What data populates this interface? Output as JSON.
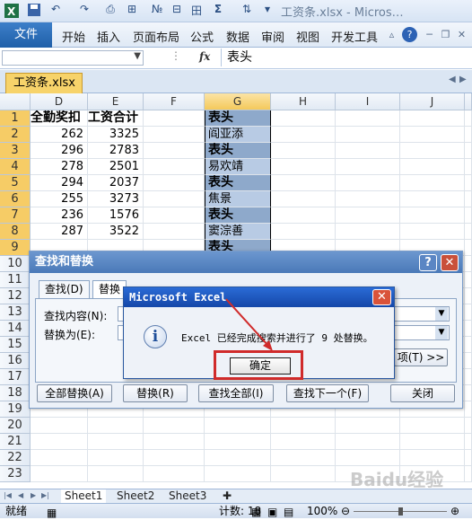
{
  "titlebar": {
    "title": "工资条.xlsx - Micros…"
  },
  "ribbon": {
    "file": "文件",
    "tabs": [
      "开始",
      "插入",
      "页面布局",
      "公式",
      "数据",
      "审阅",
      "视图",
      "开发工具"
    ]
  },
  "formula_bar": {
    "fx": "fx",
    "content": "表头"
  },
  "workbook_tab": "工资条.xlsx",
  "columns": [
    "D",
    "E",
    "F",
    "G",
    "H",
    "I",
    "J"
  ],
  "rows": [
    "1",
    "2",
    "3",
    "4",
    "5",
    "6",
    "7",
    "8",
    "9",
    "10",
    "11",
    "12",
    "13",
    "14",
    "15",
    "16",
    "17",
    "18",
    "19",
    "20",
    "21",
    "22",
    "23"
  ],
  "col_d": [
    "全勤奖扣",
    "262",
    "296",
    "278",
    "294",
    "255",
    "236",
    "287"
  ],
  "col_e": [
    "工资合计",
    "3325",
    "2783",
    "2501",
    "2037",
    "3273",
    "1576",
    "3522"
  ],
  "col_g": [
    "表头",
    "阎亚添",
    "表头",
    "易欢靖",
    "表头",
    "焦景",
    "表头",
    "窦淙善",
    "表头"
  ],
  "sheets": [
    "Sheet1",
    "Sheet2",
    "Sheet3"
  ],
  "status": {
    "ready": "就绪",
    "count": "计数: 18",
    "zoom": "100%"
  },
  "find_replace": {
    "title": "查找和替换",
    "tab_find": "查找(D)",
    "tab_replace": "替换",
    "find_label": "查找内容(N):",
    "replace_label": "替换为(E):",
    "options_btn": "项(T) >>",
    "replace_all": "全部替换(A)",
    "replace": "替换(R)",
    "find_all": "查找全部(I)",
    "find_next": "查找下一个(F)",
    "close": "关闭"
  },
  "msgbox": {
    "title": "Microsoft Excel",
    "text": "Excel 已经完成搜索并进行了 9 处替换。",
    "ok": "确定"
  },
  "watermark": "Baidu经验"
}
